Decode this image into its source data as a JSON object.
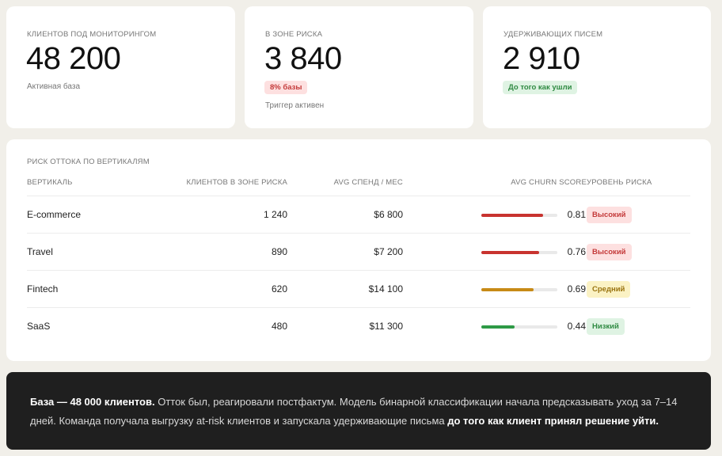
{
  "kpis": [
    {
      "label": "Клиентов под мониторингом",
      "value": "48 200",
      "sub": "Активная база"
    },
    {
      "label": "В зоне риска",
      "value": "3 840",
      "pill": "8% базы",
      "sub": "Триггер активен"
    },
    {
      "label": "Удерживающих писем",
      "value": "2 910",
      "pill": "До того как ушли"
    }
  ],
  "table": {
    "title": "Риск оттока по вертикалям",
    "headers": {
      "vertical": "Вертикаль",
      "at_risk": "Клиентов в зоне риска",
      "spend": "AVG спенд / мес",
      "score": "AVG churn score",
      "level": "Уровень риска"
    },
    "rows": [
      {
        "vertical": "E-commerce",
        "at_risk": "1 240",
        "spend": "$6 800",
        "score": "0.81",
        "score_value": 0.81,
        "bar_color": "#c8332f",
        "level": "Высокий",
        "level_kind": "red"
      },
      {
        "vertical": "Travel",
        "at_risk": "890",
        "spend": "$7 200",
        "score": "0.76",
        "score_value": 0.76,
        "bar_color": "#c8332f",
        "level": "Высокий",
        "level_kind": "red"
      },
      {
        "vertical": "Fintech",
        "at_risk": "620",
        "spend": "$14 100",
        "score": "0.69",
        "score_value": 0.69,
        "bar_color": "#c78a16",
        "level": "Средний",
        "level_kind": "yellow"
      },
      {
        "vertical": "SaaS",
        "at_risk": "480",
        "spend": "$11 300",
        "score": "0.44",
        "score_value": 0.44,
        "bar_color": "#2e9a46",
        "level": "Низкий",
        "level_kind": "green"
      }
    ]
  },
  "note": {
    "bold1": "База — 48 000 клиентов.",
    "text1": " Отток был, реагировали постфактум. Модель бинарной классификации начала предсказывать уход за 7–14 дней. Команда получала выгрузку at-risk клиентов и запускала удерживающие письма ",
    "bold2": "до того как клиент принял решение уйти."
  }
}
